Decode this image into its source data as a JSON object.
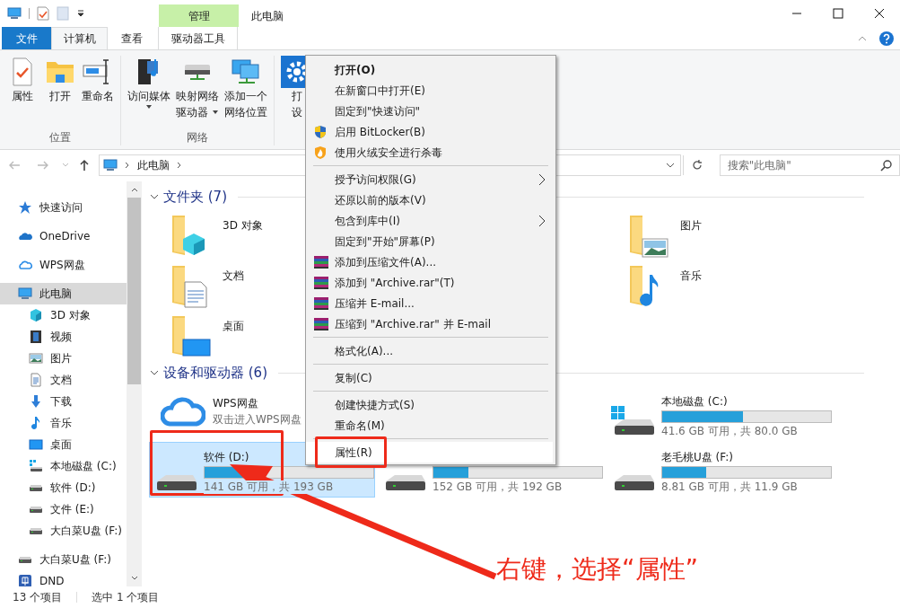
{
  "title_bar": {
    "context_tab": "管理",
    "title": "此电脑"
  },
  "ribbon_tabs": [
    {
      "label": "文件",
      "kind": "file",
      "selected": false
    },
    {
      "label": "计算机",
      "kind": "tab",
      "selected": true
    },
    {
      "label": "查看",
      "kind": "tab",
      "selected": false
    },
    {
      "label": "驱动器工具",
      "kind": "context",
      "selected": false
    }
  ],
  "ribbon_groups": [
    {
      "label": "位置",
      "buttons": [
        {
          "lines": [
            "属性"
          ],
          "dropdown": false
        },
        {
          "lines": [
            "打开"
          ],
          "dropdown": false
        },
        {
          "lines": [
            "重命名"
          ],
          "dropdown": false
        }
      ]
    },
    {
      "label": "网络",
      "buttons": [
        {
          "lines": [
            "访问媒体"
          ],
          "dropdown": true
        },
        {
          "lines": [
            "映射网络",
            "驱动器"
          ],
          "dropdown": true
        },
        {
          "lines": [
            "添加一个",
            "网络位置"
          ],
          "dropdown": false
        }
      ]
    },
    {
      "buttons": [
        {
          "lines": [
            "打",
            "设"
          ],
          "dropdown": false
        }
      ]
    }
  ],
  "address_bar": {
    "path": [
      "此电脑"
    ],
    "search_placeholder": "搜索\"此电脑\""
  },
  "nav_pane": [
    {
      "label": "快速访问",
      "selected": false
    },
    {
      "label": "OneDrive",
      "selected": false
    },
    {
      "label": "WPS网盘",
      "selected": false
    },
    {
      "label": "此电脑",
      "selected": true,
      "children": [
        {
          "label": "3D 对象",
          "selected": false
        },
        {
          "label": "视频",
          "selected": false
        },
        {
          "label": "图片",
          "selected": false
        },
        {
          "label": "文档",
          "selected": false
        },
        {
          "label": "下载",
          "selected": false
        },
        {
          "label": "音乐",
          "selected": false
        },
        {
          "label": "桌面",
          "selected": false
        },
        {
          "label": "本地磁盘 (C:)",
          "selected": false
        },
        {
          "label": "软件 (D:)",
          "selected": false
        },
        {
          "label": "文件 (E:)",
          "selected": false
        },
        {
          "label": "大白菜U盘 (F:)",
          "selected": false
        }
      ]
    },
    {
      "label": "大白菜U盘 (F:)",
      "selected": false
    },
    {
      "label": "DND",
      "selected": false
    }
  ],
  "sections": [
    {
      "title": "文件夹 (7)",
      "kind": "folders",
      "rows": [
        {
          "left": {
            "name": "3D 对象"
          },
          "right": {
            "name": "图片"
          }
        },
        {
          "left": {
            "name": "文档"
          },
          "right": {
            "name": "音乐"
          }
        },
        {
          "left": {
            "name": "桌面"
          }
        }
      ]
    },
    {
      "title": "设备和驱动器 (6)",
      "kind": "drives",
      "rows": [
        {
          "left": {
            "kind": "cloud",
            "name": "WPS网盘",
            "caption": "双击进入WPS网盘",
            "selected": false
          },
          "right": {
            "kind": "system",
            "name": "本地磁盘 (C:)",
            "level": 0.48,
            "caption": "41.6 GB 可用，共 80.0 GB",
            "selected": false
          }
        },
        {
          "left": {
            "kind": "drive",
            "name": "软件 (D:)",
            "level": 0.27,
            "caption": "141 GB 可用，共 193 GB",
            "selected": true
          },
          "middle": {
            "kind": "drive",
            "level": 0.21,
            "caption": "152 GB 可用，共 192 GB",
            "selected": false
          },
          "right": {
            "kind": "drive",
            "name": "老毛桃U盘 (F:)",
            "level": 0.26,
            "caption": "8.81 GB 可用，共 11.9 GB",
            "selected": false
          }
        }
      ]
    }
  ],
  "status_bar": [
    "13 个项目",
    "选中 1 个项目"
  ],
  "context_menu": [
    {
      "kind": "plain",
      "label": "打开(O)",
      "default": true,
      "submenu": false,
      "selected": false
    },
    {
      "kind": "plain",
      "label": "在新窗口中打开(E)",
      "default": false,
      "submenu": false,
      "selected": false
    },
    {
      "kind": "plain",
      "label": "固定到\"快速访问\"",
      "default": false,
      "submenu": false,
      "selected": false
    },
    {
      "kind": "shield",
      "label": "启用 BitLocker(B)",
      "default": false,
      "submenu": false,
      "selected": false
    },
    {
      "kind": "flame",
      "label": "使用火绒安全进行杀毒",
      "default": false,
      "submenu": false,
      "selected": false
    },
    {
      "kind": "separator"
    },
    {
      "kind": "plain",
      "label": "授予访问权限(G)",
      "default": false,
      "submenu": true,
      "selected": false
    },
    {
      "kind": "plain",
      "label": "还原以前的版本(V)",
      "default": false,
      "submenu": false,
      "selected": false
    },
    {
      "kind": "plain",
      "label": "包含到库中(I)",
      "default": false,
      "submenu": true,
      "selected": false
    },
    {
      "kind": "plain",
      "label": "固定到\"开始\"屏幕(P)",
      "default": false,
      "submenu": false,
      "selected": false
    },
    {
      "kind": "archive",
      "label": "添加到压缩文件(A)...",
      "default": false,
      "submenu": false,
      "selected": false
    },
    {
      "kind": "archive",
      "label": "添加到 \"Archive.rar\"(T)",
      "default": false,
      "submenu": false,
      "selected": false
    },
    {
      "kind": "archive",
      "label": "压缩并 E-mail...",
      "default": false,
      "submenu": false,
      "selected": false
    },
    {
      "kind": "archive",
      "label": "压缩到 \"Archive.rar\" 并 E-mail",
      "default": false,
      "submenu": false,
      "selected": false
    },
    {
      "kind": "separator"
    },
    {
      "kind": "plain",
      "label": "格式化(A)...",
      "default": false,
      "submenu": false,
      "selected": false
    },
    {
      "kind": "separator"
    },
    {
      "kind": "plain",
      "label": "复制(C)",
      "default": false,
      "submenu": false,
      "selected": false
    },
    {
      "kind": "separator"
    },
    {
      "kind": "plain",
      "label": "创建快捷方式(S)",
      "default": false,
      "submenu": false,
      "selected": false
    },
    {
      "kind": "plain",
      "label": "重命名(M)",
      "default": false,
      "submenu": false,
      "selected": false
    },
    {
      "kind": "separator"
    },
    {
      "kind": "plain",
      "label": "属性(R)",
      "default": false,
      "submenu": false,
      "selected": true
    }
  ],
  "annotation": {
    "text": "右键，选择“属性”"
  }
}
